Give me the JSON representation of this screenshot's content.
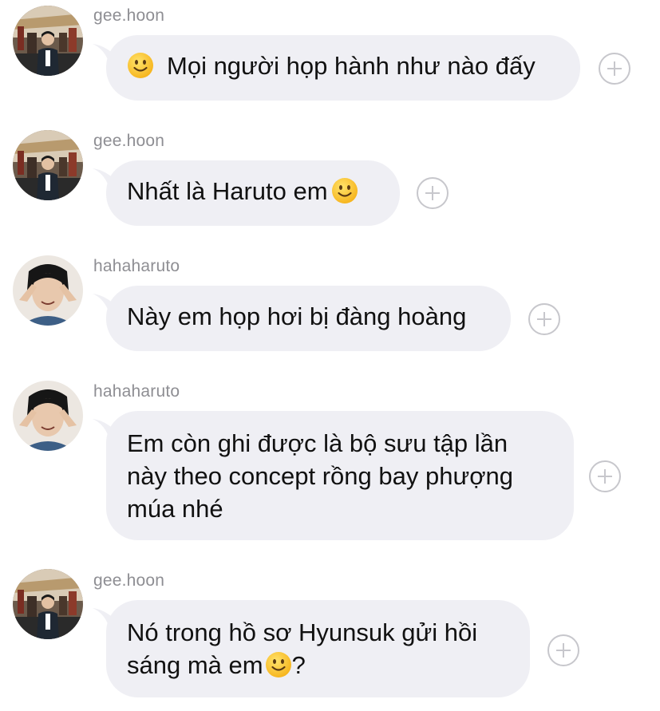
{
  "messages": [
    {
      "sender": "gee.hoon",
      "avatar": "avatar-geehoon",
      "lead_emoji": "slightly-smiling-face",
      "text": "Mọi người họp hành như nào đấy",
      "trail_emoji": "",
      "suffix": ""
    },
    {
      "sender": "gee.hoon",
      "avatar": "avatar-geehoon",
      "lead_emoji": "",
      "text": "Nhất là Haruto em",
      "trail_emoji": "slightly-smiling-face",
      "suffix": ""
    },
    {
      "sender": "hahaharuto",
      "avatar": "avatar-haruto",
      "lead_emoji": "",
      "text": "Này em họp hơi bị đàng hoàng",
      "trail_emoji": "",
      "suffix": ""
    },
    {
      "sender": "hahaharuto",
      "avatar": "avatar-haruto",
      "lead_emoji": "",
      "lines": [
        "Em còn ghi được là bộ sưu tập lần",
        "này theo concept rồng bay phượng",
        "múa nhé"
      ],
      "trail_emoji": "",
      "suffix": ""
    },
    {
      "sender": "gee.hoon",
      "avatar": "avatar-geehoon",
      "lead_emoji": "",
      "lines": [
        "Nó trong hồ sơ Hyunsuk gửi hồi",
        "sáng mà em"
      ],
      "trail_emoji": "slightly-smiling-face",
      "suffix": "?"
    }
  ],
  "colors": {
    "bubble": "#efeff4",
    "username": "#8e8e93",
    "text": "#111111",
    "react_button": "#c7c7cc"
  },
  "icons": {
    "react": "add-reaction-icon"
  }
}
